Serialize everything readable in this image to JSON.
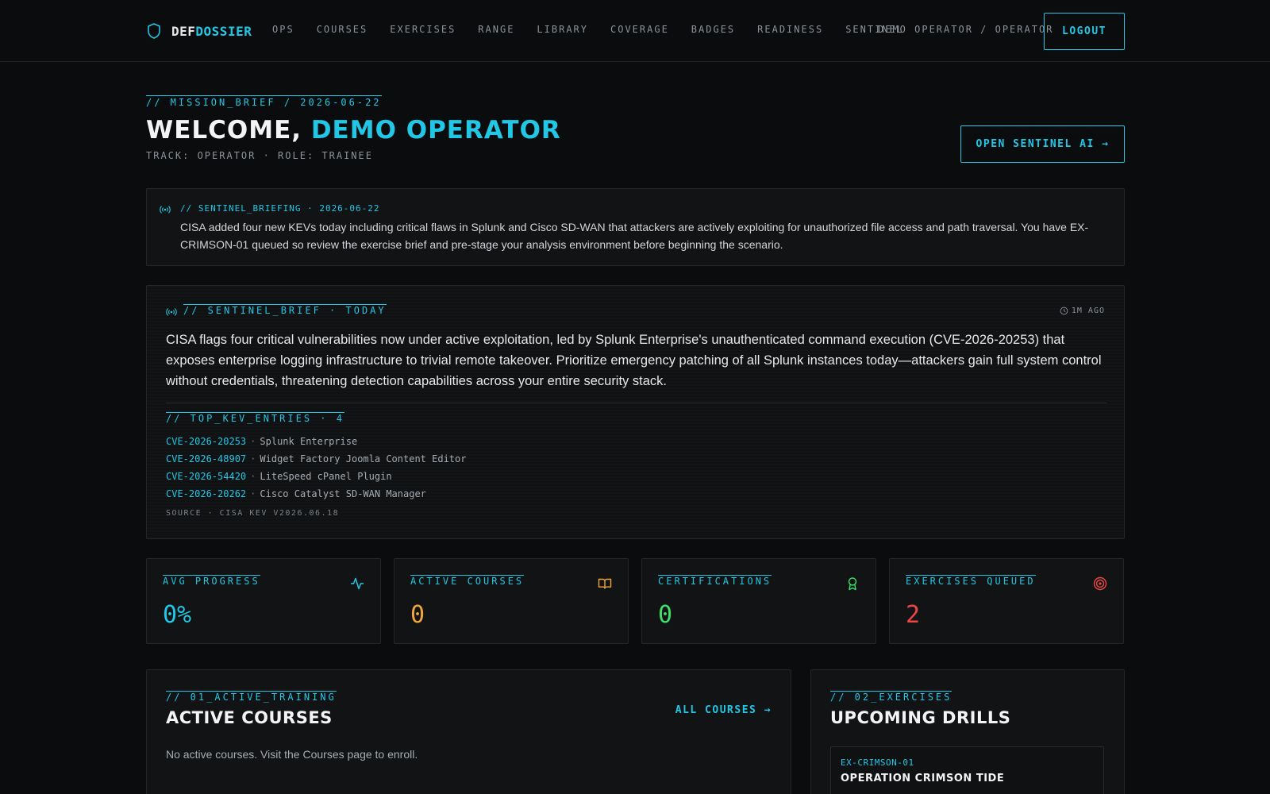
{
  "nav": {
    "brand_a": "DEF",
    "brand_b": "DOSSIER",
    "links": [
      "OPS",
      "COURSES",
      "EXERCISES",
      "RANGE",
      "LIBRARY",
      "COVERAGE",
      "BADGES",
      "READINESS",
      "SENTINEL"
    ],
    "user": "DEMO OPERATOR / OPERATOR",
    "logout": "LOGOUT"
  },
  "header": {
    "kicker": "// MISSION_BRIEF / 2026-06-22",
    "welcome_prefix": "WELCOME, ",
    "welcome_name": "DEMO OPERATOR",
    "track": "TRACK: OPERATOR · ROLE: TRAINEE",
    "open_ai": "OPEN SENTINEL AI →"
  },
  "briefing": {
    "head": "// SENTINEL_BRIEFING · 2026-06-22",
    "body": "CISA added four new KEVs today including critical flaws in Splunk and Cisco SD-WAN that attackers are actively exploiting for unauthorized file access and path traversal. You have EX-CRIMSON-01 queued so review the exercise brief and pre-stage your analysis environment before beginning the scenario."
  },
  "brief": {
    "head": "// SENTINEL_BRIEF · TODAY",
    "age": "1M AGO",
    "summary": "CISA flags four critical vulnerabilities now under active exploitation, led by Splunk Enterprise's unauthenticated command execution (CVE-2026-20253) that exposes enterprise logging infrastructure to trivial remote takeover. Prioritize emergency patching of all Splunk instances today—attackers gain full system control without credentials, threatening detection capabilities across your entire security stack.",
    "kev_head": "// TOP_KEV_ENTRIES · 4",
    "kevs": [
      {
        "id": "CVE-2026-20253",
        "vendor": "Splunk Enterprise"
      },
      {
        "id": "CVE-2026-48907",
        "vendor": "Widget Factory Joomla Content Editor"
      },
      {
        "id": "CVE-2026-54420",
        "vendor": "LiteSpeed cPanel Plugin"
      },
      {
        "id": "CVE-2026-20262",
        "vendor": "Cisco Catalyst SD-WAN Manager"
      }
    ],
    "separator": "·",
    "source": "SOURCE · CISA KEV V2026.06.18"
  },
  "stats": [
    {
      "label": "AVG PROGRESS",
      "value": "0%",
      "color": "#22c7e6",
      "icon": "activity-icon"
    },
    {
      "label": "ACTIVE COURSES",
      "value": "0",
      "color": "#f0a63a",
      "icon": "book-icon"
    },
    {
      "label": "CERTIFICATIONS",
      "value": "0",
      "color": "#3fe06a",
      "icon": "award-icon"
    },
    {
      "label": "EXERCISES QUEUED",
      "value": "2",
      "color": "#f04545",
      "icon": "target-icon"
    }
  ],
  "active": {
    "kicker": "// 01_ACTIVE_TRAINING",
    "title": "ACTIVE COURSES",
    "link": "ALL COURSES →",
    "empty": "No active courses. Visit the Courses page to enroll."
  },
  "drills": {
    "kicker": "// 02_EXERCISES",
    "title": "UPCOMING DRILLS",
    "items": [
      {
        "id": "EX-CRIMSON-01",
        "name": "OPERATION CRIMSON TIDE"
      }
    ]
  }
}
